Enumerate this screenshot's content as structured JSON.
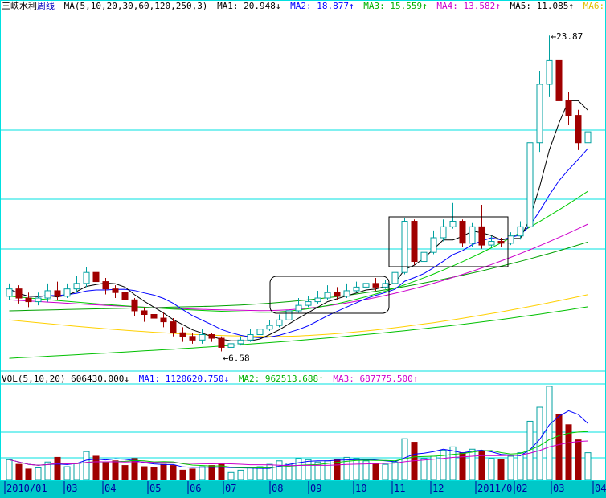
{
  "price_header": {
    "stock_name": "三峡水利",
    "period": "周线",
    "ma_params": "MA(5,10,20,30,60,120,250,3)",
    "ma1": "MA1: 20.948↓",
    "ma2": "MA2: 18.877↑",
    "ma3": "MA3: 15.559↑",
    "ma4": "MA4: 13.582↑",
    "ma5": "MA5: 11.085↑",
    "ma6": "MA6: 8.997↑",
    "ma7": "M"
  },
  "volume_header": {
    "vol_params": "VOL(5,10,20)",
    "vol_value": "606430.000↓",
    "ma1": "MA1: 1120620.750↓",
    "ma2": "MA2: 962513.688↑",
    "ma3": "MA3: 687775.500↑"
  },
  "annotations": {
    "high": "←23.87",
    "low": "←6.58"
  },
  "x_axis_labels": [
    "2010/01",
    "03",
    "04",
    "05",
    "06",
    "07",
    "08",
    "09",
    "10",
    "11",
    "12",
    "2011/0",
    "02",
    "03",
    "04"
  ],
  "colors": {
    "up": "#00a0a0",
    "down": "#a00000",
    "grid": "#00e0e0",
    "axis_bg": "#00c8c8",
    "ma1": "#000000",
    "ma2": "#0000ff",
    "ma3": "#00cc00",
    "ma4": "#cc00cc",
    "ma5": "#00a000",
    "ma6": "#ffd000",
    "ma7": "#00c000",
    "vol_ma1": "#0000ff",
    "vol_ma2": "#00cc00",
    "vol_ma3": "#cc00cc"
  },
  "chart_data": {
    "type": "candlestick",
    "title": "三峡水利 周线",
    "weeks": 61,
    "high_marker": 23.87,
    "low_marker": 6.58,
    "ohlc": [
      [
        9.6,
        10.0,
        10.3,
        9.4
      ],
      [
        10.0,
        9.5,
        10.2,
        9.2
      ],
      [
        9.5,
        9.3,
        9.8,
        9.0
      ],
      [
        9.3,
        9.5,
        9.8,
        9.1
      ],
      [
        9.5,
        9.9,
        10.3,
        9.3
      ],
      [
        9.9,
        9.6,
        10.4,
        9.4
      ],
      [
        9.6,
        10.0,
        10.3,
        9.5
      ],
      [
        10.0,
        10.3,
        10.7,
        9.8
      ],
      [
        10.3,
        10.9,
        11.2,
        10.1
      ],
      [
        10.9,
        10.4,
        11.1,
        10.2
      ],
      [
        10.4,
        10.0,
        10.6,
        9.7
      ],
      [
        10.0,
        9.8,
        10.2,
        9.5
      ],
      [
        9.8,
        9.4,
        10.0,
        9.2
      ],
      [
        9.4,
        8.8,
        9.5,
        8.5
      ],
      [
        8.8,
        8.6,
        9.0,
        8.2
      ],
      [
        8.6,
        8.4,
        8.9,
        8.0
      ],
      [
        8.4,
        8.2,
        8.7,
        7.9
      ],
      [
        8.2,
        7.6,
        8.4,
        7.4
      ],
      [
        7.6,
        7.4,
        7.9,
        7.1
      ],
      [
        7.4,
        7.2,
        7.6,
        7.0
      ],
      [
        7.2,
        7.5,
        7.8,
        7.0
      ],
      [
        7.5,
        7.3,
        7.6,
        7.1
      ],
      [
        7.3,
        6.8,
        7.4,
        6.58
      ],
      [
        6.8,
        7.0,
        7.3,
        6.7
      ],
      [
        7.0,
        7.2,
        7.4,
        6.9
      ],
      [
        7.2,
        7.5,
        7.8,
        7.1
      ],
      [
        7.5,
        7.8,
        8.0,
        7.4
      ],
      [
        7.8,
        8.0,
        8.3,
        7.7
      ],
      [
        8.0,
        8.3,
        8.6,
        7.9
      ],
      [
        8.3,
        8.8,
        9.0,
        8.2
      ],
      [
        8.8,
        9.1,
        9.5,
        8.7
      ],
      [
        9.1,
        9.3,
        9.6,
        9.0
      ],
      [
        9.3,
        9.5,
        9.9,
        9.2
      ],
      [
        9.5,
        9.8,
        10.2,
        9.4
      ],
      [
        9.8,
        9.6,
        10.1,
        9.4
      ],
      [
        9.6,
        9.9,
        10.3,
        9.5
      ],
      [
        9.9,
        10.1,
        10.4,
        9.8
      ],
      [
        10.1,
        10.3,
        10.6,
        10.0
      ],
      [
        10.3,
        10.1,
        10.6,
        9.9
      ],
      [
        10.1,
        10.3,
        10.5,
        10.0
      ],
      [
        10.3,
        10.9,
        11.0,
        10.2
      ],
      [
        10.9,
        13.7,
        13.9,
        10.8
      ],
      [
        13.7,
        11.5,
        13.8,
        11.3
      ],
      [
        11.5,
        12.0,
        12.5,
        11.3
      ],
      [
        12.0,
        12.8,
        13.2,
        11.9
      ],
      [
        12.8,
        13.4,
        13.8,
        12.6
      ],
      [
        13.4,
        13.7,
        14.7,
        13.3
      ],
      [
        13.7,
        12.5,
        13.8,
        12.3
      ],
      [
        12.5,
        13.4,
        13.6,
        12.3
      ],
      [
        13.4,
        12.4,
        14.6,
        12.2
      ],
      [
        12.4,
        12.6,
        12.9,
        12.3
      ],
      [
        12.6,
        12.5,
        12.8,
        12.3
      ],
      [
        12.5,
        12.9,
        13.1,
        12.4
      ],
      [
        12.9,
        13.4,
        13.7,
        12.7
      ],
      [
        13.4,
        18.0,
        18.6,
        13.2
      ],
      [
        18.0,
        21.2,
        21.9,
        17.5
      ],
      [
        21.2,
        22.5,
        23.87,
        20.5
      ],
      [
        22.5,
        20.3,
        22.8,
        19.8
      ],
      [
        20.3,
        19.5,
        20.8,
        19.0
      ],
      [
        19.5,
        18.0,
        19.8,
        17.6
      ],
      [
        18.0,
        18.6,
        19.0,
        17.8
      ]
    ],
    "volume": [
      170,
      130,
      90,
      100,
      150,
      190,
      110,
      140,
      240,
      200,
      150,
      160,
      120,
      180,
      110,
      100,
      130,
      120,
      80,
      90,
      110,
      120,
      130,
      60,
      80,
      100,
      110,
      130,
      160,
      140,
      180,
      170,
      150,
      160,
      170,
      190,
      180,
      160,
      140,
      130,
      150,
      350,
      320,
      180,
      200,
      250,
      280,
      230,
      260,
      240,
      180,
      170,
      200,
      230,
      500,
      620,
      800,
      560,
      470,
      340,
      230
    ],
    "ma_ranges": {
      "MA1": "20.948",
      "MA2": "18.877",
      "MA3": "15.559",
      "MA4": "13.582",
      "MA5": "11.085",
      "MA6": "8.997"
    },
    "vol_ma_values": {
      "vol": 606430.0,
      "MA1": 1120620.75,
      "MA2": 962513.688,
      "MA3": 687775.5
    },
    "x_labels": [
      "2010/01",
      "03",
      "04",
      "05",
      "06",
      "07",
      "08",
      "09",
      "10",
      "11",
      "12",
      "2011/0",
      "02",
      "03",
      "04"
    ],
    "grid": true
  }
}
